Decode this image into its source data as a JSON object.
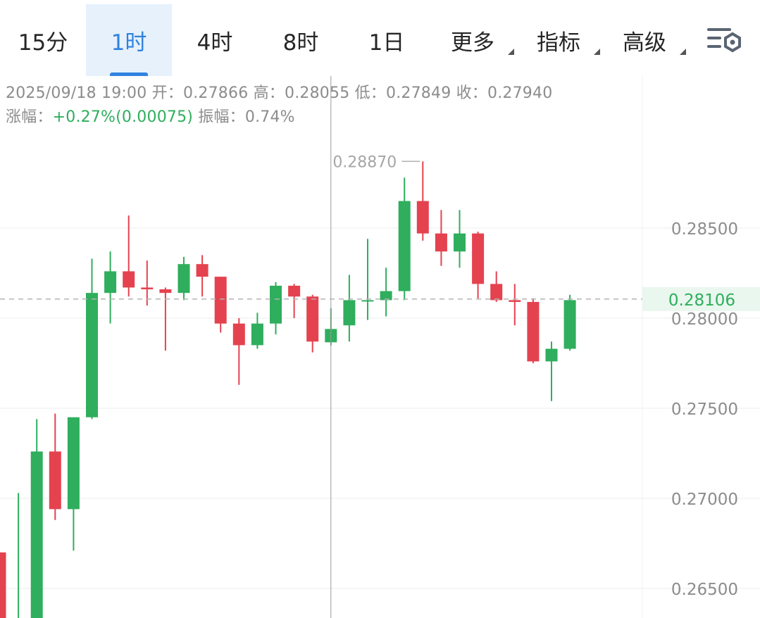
{
  "tabs": [
    {
      "label": "15分",
      "active": false,
      "dropdown": false
    },
    {
      "label": "1时",
      "active": true,
      "dropdown": false
    },
    {
      "label": "4时",
      "active": false,
      "dropdown": false
    },
    {
      "label": "8时",
      "active": false,
      "dropdown": false
    },
    {
      "label": "1日",
      "active": false,
      "dropdown": false
    },
    {
      "label": "更多",
      "active": false,
      "dropdown": true
    },
    {
      "label": "指标",
      "active": false,
      "dropdown": true
    },
    {
      "label": "高级",
      "active": false,
      "dropdown": true
    }
  ],
  "settings_icon": "chart-settings-icon",
  "info": {
    "datetime": "2025/09/18 19:00",
    "open_label": "开：",
    "open": "0.27866",
    "high_label": "高：",
    "high": "0.28055",
    "low_label": "低：",
    "low": "0.27849",
    "close_label": "收：",
    "close": "0.27940",
    "change_label": "涨幅：",
    "change": "+0.27%(0.00075)",
    "amplitude_label": "振幅：",
    "amplitude": "0.74%"
  },
  "colors": {
    "up": "#2fae5d",
    "down": "#e5424f",
    "accent": "#2f82df",
    "grid": "#eeeeee",
    "crosshair": "#9a9a9a"
  },
  "chart_data": {
    "type": "candlestick",
    "ylim": [
      0.2635,
      0.2915
    ],
    "y_ticks": [
      "0.28500",
      "0.28000",
      "0.27500",
      "0.27000",
      "0.26500"
    ],
    "y_tick_values": [
      0.285,
      0.28,
      0.275,
      0.27,
      0.265
    ],
    "current_price": 0.28106,
    "current_price_label": "0.28106",
    "max_label": "0.28870",
    "max_value": 0.2887,
    "crosshair_candle_index": 17,
    "candles": [
      {
        "o": 0.267,
        "h": 0.267,
        "l": 0.263,
        "c": 0.263
      },
      {
        "o": 0.263,
        "h": 0.2703,
        "l": 0.263,
        "c": 0.263
      },
      {
        "o": 0.263,
        "h": 0.2744,
        "l": 0.263,
        "c": 0.2726
      },
      {
        "o": 0.2726,
        "h": 0.2747,
        "l": 0.2688,
        "c": 0.2694
      },
      {
        "o": 0.2694,
        "h": 0.2744,
        "l": 0.2671,
        "c": 0.2745
      },
      {
        "o": 0.2745,
        "h": 0.2833,
        "l": 0.2744,
        "c": 0.2814
      },
      {
        "o": 0.2814,
        "h": 0.2837,
        "l": 0.2797,
        "c": 0.2826
      },
      {
        "o": 0.2826,
        "h": 0.2857,
        "l": 0.2812,
        "c": 0.2817
      },
      {
        "o": 0.2817,
        "h": 0.2832,
        "l": 0.2807,
        "c": 0.2816
      },
      {
        "o": 0.2816,
        "h": 0.2817,
        "l": 0.2782,
        "c": 0.2814
      },
      {
        "o": 0.2814,
        "h": 0.2834,
        "l": 0.281,
        "c": 0.283
      },
      {
        "o": 0.283,
        "h": 0.2835,
        "l": 0.2812,
        "c": 0.2823
      },
      {
        "o": 0.2823,
        "h": 0.2823,
        "l": 0.2792,
        "c": 0.2797
      },
      {
        "o": 0.2797,
        "h": 0.28,
        "l": 0.2763,
        "c": 0.2785
      },
      {
        "o": 0.2785,
        "h": 0.2803,
        "l": 0.2783,
        "c": 0.2797
      },
      {
        "o": 0.2797,
        "h": 0.282,
        "l": 0.2791,
        "c": 0.2818
      },
      {
        "o": 0.2818,
        "h": 0.2819,
        "l": 0.28,
        "c": 0.2812
      },
      {
        "o": 0.2812,
        "h": 0.2813,
        "l": 0.2781,
        "c": 0.2787
      },
      {
        "o": 0.27866,
        "h": 0.28055,
        "l": 0.27849,
        "c": 0.2794
      },
      {
        "o": 0.2796,
        "h": 0.2824,
        "l": 0.2787,
        "c": 0.281
      },
      {
        "o": 0.281,
        "h": 0.2844,
        "l": 0.2799,
        "c": 0.281
      },
      {
        "o": 0.281,
        "h": 0.2828,
        "l": 0.2801,
        "c": 0.2815
      },
      {
        "o": 0.2815,
        "h": 0.2878,
        "l": 0.281,
        "c": 0.2865
      },
      {
        "o": 0.2865,
        "h": 0.2887,
        "l": 0.2843,
        "c": 0.2847
      },
      {
        "o": 0.2847,
        "h": 0.286,
        "l": 0.2829,
        "c": 0.2837
      },
      {
        "o": 0.2837,
        "h": 0.286,
        "l": 0.2828,
        "c": 0.2847
      },
      {
        "o": 0.2847,
        "h": 0.2848,
        "l": 0.2811,
        "c": 0.2819
      },
      {
        "o": 0.2819,
        "h": 0.2826,
        "l": 0.2809,
        "c": 0.281
      },
      {
        "o": 0.281,
        "h": 0.2819,
        "l": 0.2796,
        "c": 0.2809
      },
      {
        "o": 0.2809,
        "h": 0.2811,
        "l": 0.2775,
        "c": 0.2776
      },
      {
        "o": 0.2776,
        "h": 0.2787,
        "l": 0.2754,
        "c": 0.2783
      },
      {
        "o": 0.2783,
        "h": 0.2813,
        "l": 0.2782,
        "c": 0.281
      }
    ]
  }
}
